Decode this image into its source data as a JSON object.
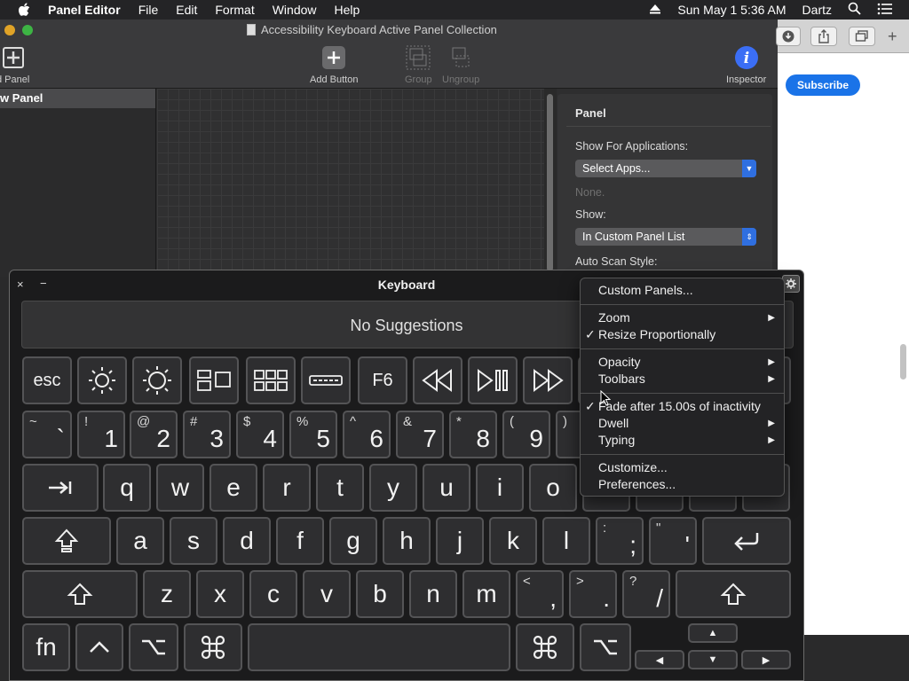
{
  "menubar": {
    "app_name": "Panel Editor",
    "menus": [
      "File",
      "Edit",
      "Format",
      "Window",
      "Help"
    ],
    "datetime": "Sun May 1  5:36 AM",
    "user": "Dartz"
  },
  "panel_editor": {
    "title": "Accessibility Keyboard Active Panel Collection",
    "toolbar": {
      "add_panel": "d Panel",
      "add_button": "Add Button",
      "group": "Group",
      "ungroup": "Ungroup",
      "inspector": "Inspector"
    },
    "sidebar": {
      "selected_row": "w Panel"
    },
    "inspector": {
      "section_title": "Panel",
      "show_for_apps_label": "Show For Applications:",
      "apps_popup": "Select Apps...",
      "apps_none": "None.",
      "show_label": "Show:",
      "show_popup": "In Custom Panel List",
      "auto_scan_label": "Auto Scan Style:"
    }
  },
  "browser": {
    "subscribe_label": "Subscribe"
  },
  "keyboard": {
    "title": "Keyboard",
    "close": "×",
    "minimize": "−",
    "suggestions": "No Suggestions",
    "fn_row": [
      "esc",
      "F6"
    ],
    "number_row": [
      {
        "sub": "~",
        "main": "`"
      },
      {
        "sub": "!",
        "main": "1"
      },
      {
        "sub": "@",
        "main": "2"
      },
      {
        "sub": "#",
        "main": "3"
      },
      {
        "sub": "$",
        "main": "4"
      },
      {
        "sub": "%",
        "main": "5"
      },
      {
        "sub": "^",
        "main": "6"
      },
      {
        "sub": "&",
        "main": "7"
      },
      {
        "sub": "*",
        "main": "8"
      },
      {
        "sub": "(",
        "main": "9"
      },
      {
        "sub": ")",
        "main": ""
      }
    ],
    "qwerty_row": [
      "q",
      "w",
      "e",
      "r",
      "t",
      "y",
      "u",
      "i",
      "o"
    ],
    "home_row": [
      "a",
      "s",
      "d",
      "f",
      "g",
      "h",
      "j",
      "k",
      "l"
    ],
    "home_punct": [
      {
        "sub": ":",
        "main": ";"
      },
      {
        "sub": "\"",
        "main": "'"
      }
    ],
    "bottom_row": [
      "z",
      "x",
      "c",
      "v",
      "b",
      "n",
      "m"
    ],
    "bottom_punct": [
      {
        "sub": "<",
        "main": ","
      },
      {
        "sub": ">",
        "main": "."
      },
      {
        "sub": "?",
        "main": "/"
      }
    ],
    "fn_key": "fn"
  },
  "context_menu": {
    "custom_panels": "Custom Panels...",
    "zoom": "Zoom",
    "resize_proportionally": "Resize Proportionally",
    "opacity": "Opacity",
    "toolbars": "Toolbars",
    "fade": "Fade after 15.00s of inactivity",
    "dwell": "Dwell",
    "typing": "Typing",
    "customize": "Customize...",
    "preferences": "Preferences...",
    "check": "✓",
    "submenu_arrow": "▶"
  },
  "colors": {
    "accent_blue": "#2f6fe0",
    "subscribe_blue": "#1a73e8",
    "inspector_icon": "#3b6ef5"
  }
}
